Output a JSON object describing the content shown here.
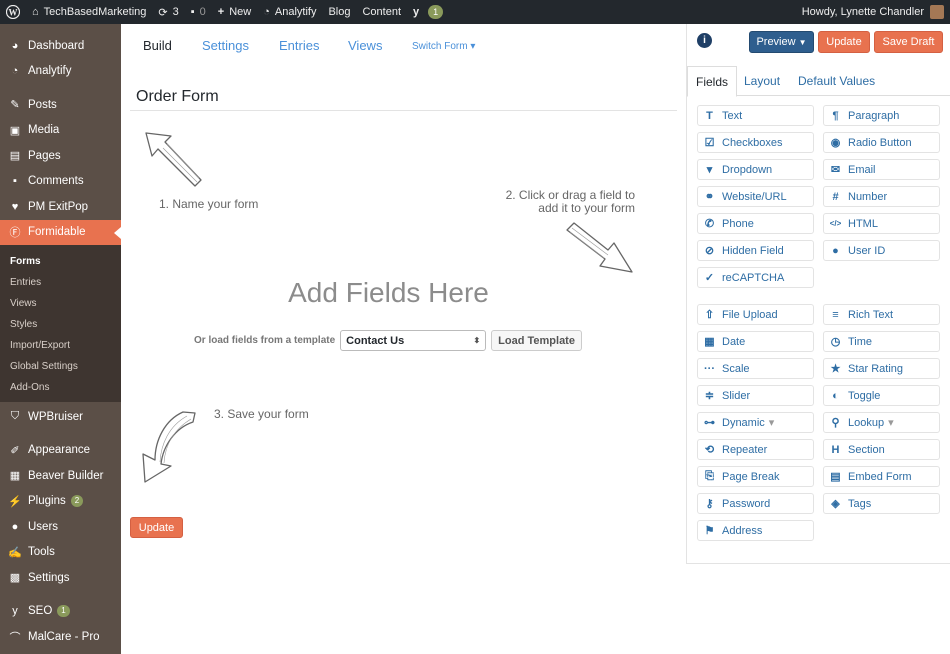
{
  "adminbar": {
    "site_name": "TechBasedMarketing",
    "updates_count": "3",
    "comments_count": "0",
    "new_label": "New",
    "analytify_label": "Analytify",
    "blog_label": "Blog",
    "content_label": "Content",
    "yoast_count": "1",
    "howdy": "Howdy, Lynette Chandler"
  },
  "sidebar": {
    "items_top": [
      {
        "label": "Dashboard",
        "icon": "dashboard-icon"
      },
      {
        "label": "Analytify",
        "icon": "analytify-icon"
      },
      {
        "label": "Posts",
        "icon": "pin-icon"
      },
      {
        "label": "Media",
        "icon": "media-icon"
      },
      {
        "label": "Pages",
        "icon": "pages-icon"
      },
      {
        "label": "Comments",
        "icon": "comment-icon"
      },
      {
        "label": "PM ExitPop",
        "icon": "heart-icon"
      },
      {
        "label": "Formidable",
        "icon": "formidable-icon"
      }
    ],
    "submenu": [
      "Forms",
      "Entries",
      "Views",
      "Styles",
      "Import/Export",
      "Global Settings",
      "Add-Ons"
    ],
    "items_bottom": [
      {
        "label": "WPBruiser",
        "icon": "shield-icon"
      },
      {
        "label": "Appearance",
        "icon": "brush-icon"
      },
      {
        "label": "Beaver Builder",
        "icon": "grid-icon"
      },
      {
        "label": "Plugins",
        "icon": "plugin-icon",
        "badge": "2"
      },
      {
        "label": "Users",
        "icon": "user-icon"
      },
      {
        "label": "Tools",
        "icon": "wrench-icon"
      },
      {
        "label": "Settings",
        "icon": "settings-icon"
      },
      {
        "label": "SEO",
        "icon": "yoast-icon",
        "badge": "1"
      },
      {
        "label": "MalCare - Pro",
        "icon": "malcare-icon"
      }
    ]
  },
  "main": {
    "tabs": [
      "Build",
      "Settings",
      "Entries",
      "Views"
    ],
    "switch_form": "Switch Form",
    "form_title": "Order Form",
    "hint_name": "1. Name your form",
    "hint_drag_1": "2. Click or drag a field to",
    "hint_drag_2": "add it to your form",
    "hint_save": "3. Save your form",
    "add_fields": "Add Fields Here",
    "template_label": "Or load fields from a template",
    "template_selected": "Contact Us",
    "load_template": "Load Template",
    "update": "Update"
  },
  "right": {
    "preview": "Preview",
    "update": "Update",
    "save_draft": "Save Draft",
    "tabs": [
      "Fields",
      "Layout",
      "Default Values"
    ],
    "fields_basic": [
      {
        "label": "Text",
        "icon": "text-icon"
      },
      {
        "label": "Paragraph",
        "icon": "paragraph-icon"
      },
      {
        "label": "Checkboxes",
        "icon": "checkbox-icon"
      },
      {
        "label": "Radio Button",
        "icon": "radio-icon"
      },
      {
        "label": "Dropdown",
        "icon": "dropdown-icon"
      },
      {
        "label": "Email",
        "icon": "email-icon"
      },
      {
        "label": "Website/URL",
        "icon": "link-icon"
      },
      {
        "label": "Number",
        "icon": "hash-icon"
      },
      {
        "label": "Phone",
        "icon": "phone-icon"
      },
      {
        "label": "HTML",
        "icon": "code-icon"
      },
      {
        "label": "Hidden Field",
        "icon": "eye-slash-icon"
      },
      {
        "label": "User ID",
        "icon": "user-icon"
      },
      {
        "label": "reCAPTCHA",
        "icon": "shield-check-icon"
      }
    ],
    "fields_advanced": [
      {
        "label": "File Upload",
        "icon": "upload-icon"
      },
      {
        "label": "Rich Text",
        "icon": "align-icon"
      },
      {
        "label": "Date",
        "icon": "calendar-icon"
      },
      {
        "label": "Time",
        "icon": "clock-icon"
      },
      {
        "label": "Scale",
        "icon": "dots-icon"
      },
      {
        "label": "Star Rating",
        "icon": "star-icon"
      },
      {
        "label": "Slider",
        "icon": "sliders-icon"
      },
      {
        "label": "Toggle",
        "icon": "toggle-icon"
      },
      {
        "label": "Dynamic",
        "icon": "sitemap-icon",
        "caret": true
      },
      {
        "label": "Lookup",
        "icon": "search-icon",
        "caret": true
      },
      {
        "label": "Repeater",
        "icon": "repeat-icon"
      },
      {
        "label": "Section",
        "icon": "heading-icon"
      },
      {
        "label": "Page Break",
        "icon": "page-break-icon"
      },
      {
        "label": "Embed Form",
        "icon": "table-icon"
      },
      {
        "label": "Password",
        "icon": "key-icon"
      },
      {
        "label": "Tags",
        "icon": "tags-icon"
      },
      {
        "label": "Address",
        "icon": "map-marker-icon"
      }
    ]
  },
  "colors": {
    "accent": "#e8724f",
    "primary": "#2e5e8e",
    "link": "#2e6da4",
    "sidebar": "#5b4f47",
    "adminbar": "#23282d"
  }
}
